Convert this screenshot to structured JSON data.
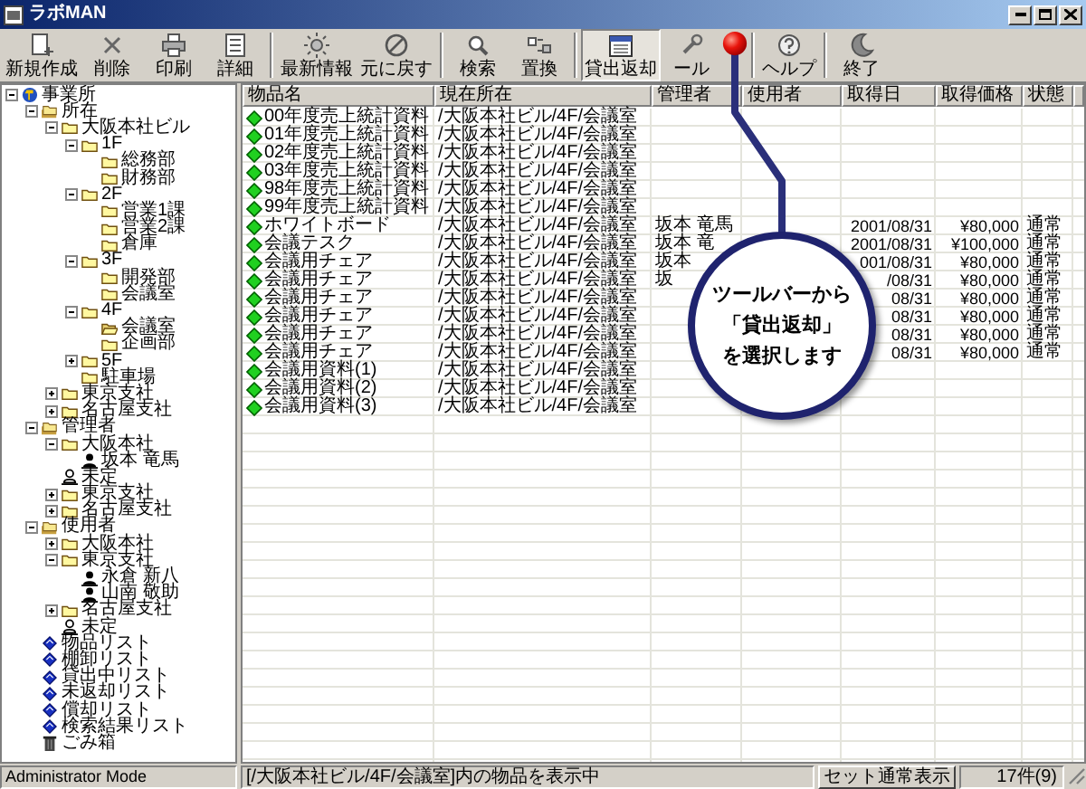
{
  "window": {
    "title": "ラボMAN"
  },
  "toolbar": [
    {
      "buttons": [
        {
          "label": "新規作成",
          "selected": false
        },
        {
          "label": "削除",
          "selected": false
        },
        {
          "label": "印刷",
          "selected": false
        },
        {
          "label": "詳細",
          "selected": false
        }
      ]
    },
    {
      "buttons": [
        {
          "label": "最新情報",
          "selected": false
        },
        {
          "label": "元に戻す",
          "selected": false
        }
      ]
    },
    {
      "buttons": [
        {
          "label": "検索",
          "selected": false
        },
        {
          "label": "置換",
          "selected": false
        }
      ]
    },
    {
      "buttons": [
        {
          "label": "貸出返却",
          "selected": true
        },
        {
          "label": "ール",
          "selected": false
        }
      ]
    },
    {
      "buttons": [
        {
          "label": "ヘルプ",
          "selected": false
        }
      ]
    },
    {
      "buttons": [
        {
          "label": "終了",
          "selected": false
        }
      ]
    }
  ],
  "tree": [
    {
      "label": "事業所",
      "kind": "root",
      "expanded": true,
      "children": [
        {
          "label": "所在",
          "kind": "group",
          "expanded": true,
          "children": [
            {
              "label": "大阪本社ビル",
              "kind": "folder",
              "expanded": true,
              "children": [
                {
                  "label": "1F",
                  "kind": "folder",
                  "expanded": true,
                  "children": [
                    {
                      "label": "総務部",
                      "kind": "folder"
                    },
                    {
                      "label": "財務部",
                      "kind": "folder"
                    }
                  ]
                },
                {
                  "label": "2F",
                  "kind": "folder",
                  "expanded": true,
                  "children": [
                    {
                      "label": "営業1課",
                      "kind": "folder"
                    },
                    {
                      "label": "営業2課",
                      "kind": "folder"
                    },
                    {
                      "label": "倉庫",
                      "kind": "folder"
                    }
                  ]
                },
                {
                  "label": "3F",
                  "kind": "folder",
                  "expanded": true,
                  "children": [
                    {
                      "label": "開発部",
                      "kind": "folder"
                    },
                    {
                      "label": "会議室",
                      "kind": "folder"
                    }
                  ]
                },
                {
                  "label": "4F",
                  "kind": "folder",
                  "expanded": true,
                  "children": [
                    {
                      "label": "会議室",
                      "kind": "open_folder"
                    },
                    {
                      "label": "企画部",
                      "kind": "folder"
                    }
                  ]
                },
                {
                  "label": "5F",
                  "kind": "folder",
                  "expanded": false
                },
                {
                  "label": "駐車場",
                  "kind": "folder"
                }
              ]
            },
            {
              "label": "東京支社",
              "kind": "folder",
              "expanded": false
            },
            {
              "label": "名古屋支社",
              "kind": "folder",
              "expanded": false
            }
          ]
        },
        {
          "label": "管理者",
          "kind": "group",
          "expanded": true,
          "children": [
            {
              "label": "大阪本社",
              "kind": "folder",
              "expanded": true,
              "children": [
                {
                  "label": "坂本 竜馬",
                  "kind": "person"
                }
              ]
            },
            {
              "label": "未定",
              "kind": "undecided"
            },
            {
              "label": "東京支社",
              "kind": "folder",
              "expanded": false
            },
            {
              "label": "名古屋支社",
              "kind": "folder",
              "expanded": false
            }
          ]
        },
        {
          "label": "使用者",
          "kind": "group",
          "expanded": true,
          "children": [
            {
              "label": "大阪本社",
              "kind": "folder",
              "expanded": false
            },
            {
              "label": "東京支社",
              "kind": "folder",
              "expanded": true,
              "children": [
                {
                  "label": "永倉 新八",
                  "kind": "person"
                },
                {
                  "label": "山南 敬助",
                  "kind": "person"
                }
              ]
            },
            {
              "label": "名古屋支社",
              "kind": "folder",
              "expanded": false
            },
            {
              "label": "未定",
              "kind": "undecided"
            }
          ]
        },
        {
          "label": "物品リスト",
          "kind": "list"
        },
        {
          "label": "棚卸リスト",
          "kind": "list"
        },
        {
          "label": "貸出中リスト",
          "kind": "list"
        },
        {
          "label": "未返却リスト",
          "kind": "list"
        },
        {
          "label": "償却リスト",
          "kind": "list"
        },
        {
          "label": "検索結果リスト",
          "kind": "list"
        },
        {
          "label": "ごみ箱",
          "kind": "trash"
        }
      ]
    }
  ],
  "table": {
    "columns": [
      "物品名",
      "現在所在",
      "管理者",
      "使用者",
      "取得日",
      "取得価格",
      "状態"
    ],
    "rows": [
      {
        "name": "00年度売上統計資料",
        "location": "/大阪本社ビル/4F/会議室"
      },
      {
        "name": "01年度売上統計資料",
        "location": "/大阪本社ビル/4F/会議室"
      },
      {
        "name": "02年度売上統計資料",
        "location": "/大阪本社ビル/4F/会議室"
      },
      {
        "name": "03年度売上統計資料",
        "location": "/大阪本社ビル/4F/会議室"
      },
      {
        "name": "98年度売上統計資料",
        "location": "/大阪本社ビル/4F/会議室"
      },
      {
        "name": "99年度売上統計資料",
        "location": "/大阪本社ビル/4F/会議室"
      },
      {
        "name": "ホワイトボード",
        "location": "/大阪本社ビル/4F/会議室",
        "manager": "坂本 竜馬",
        "acquired": "2001/08/31",
        "price": "¥80,000",
        "status": "通常"
      },
      {
        "name": "会議テスク",
        "location": "/大阪本社ビル/4F/会議室",
        "manager": "坂本 竜",
        "acquired": "2001/08/31",
        "price": "¥100,000",
        "status": "通常"
      },
      {
        "name": "会議用チェア",
        "location": "/大阪本社ビル/4F/会議室",
        "manager": "坂本",
        "acquired": "001/08/31",
        "price": "¥80,000",
        "status": "通常"
      },
      {
        "name": "会議用チェア",
        "location": "/大阪本社ビル/4F/会議室",
        "manager": "坂",
        "acquired": "/08/31",
        "price": "¥80,000",
        "status": "通常"
      },
      {
        "name": "会議用チェア",
        "location": "/大阪本社ビル/4F/会議室",
        "acquired": "08/31",
        "price": "¥80,000",
        "status": "通常"
      },
      {
        "name": "会議用チェア",
        "location": "/大阪本社ビル/4F/会議室",
        "acquired": "08/31",
        "price": "¥80,000",
        "status": "通常"
      },
      {
        "name": "会議用チェア",
        "location": "/大阪本社ビル/4F/会議室",
        "acquired": "08/31",
        "price": "¥80,000",
        "status": "通常"
      },
      {
        "name": "会議用チェア",
        "location": "/大阪本社ビル/4F/会議室",
        "acquired": "08/31",
        "price": "¥80,000",
        "status": "通常"
      },
      {
        "name": "会議用資料(1)",
        "location": "/大阪本社ビル/4F/会議室"
      },
      {
        "name": "会議用資料(2)",
        "location": "/大阪本社ビル/4F/会議室"
      },
      {
        "name": "会議用資料(3)",
        "location": "/大阪本社ビル/4F/会議室"
      }
    ]
  },
  "status_bar": {
    "mode": "Administrator Mode",
    "message": "[/大阪本社ビル/4F/会議室]内の物品を表示中",
    "button": "セット通常表示",
    "count": "17件(9)"
  },
  "callout": {
    "lines": [
      "ツールバーから",
      "「貸出返却」",
      "を選択します"
    ]
  }
}
